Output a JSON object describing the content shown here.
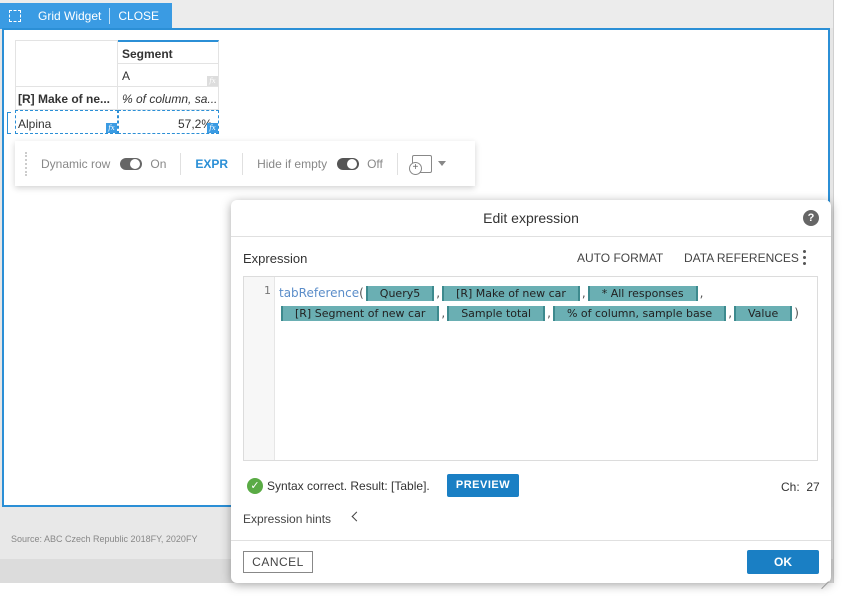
{
  "widget_tab": {
    "title": "Grid Widget",
    "close_label": "CLOSE"
  },
  "grid": {
    "column_header": "Segment",
    "column_sub": "A",
    "row_header": "[R] Make of ne...",
    "row_measure": "% of column, sa...",
    "row_label": "Alpina",
    "row_value": "57,2%",
    "fx_label": "fx"
  },
  "toolbar": {
    "dynamic_row_label": "Dynamic row",
    "dynamic_row_state": "On",
    "expr_label": "EXPR",
    "hide_if_empty_label": "Hide if empty",
    "hide_if_empty_state": "Off"
  },
  "footer": {
    "source": "Source: ABC Czech Republic 2018FY, 2020FY"
  },
  "dialog": {
    "title": "Edit expression",
    "help": "?",
    "expression_label": "Expression",
    "auto_format": "AUTO FORMAT",
    "data_references": "DATA REFERENCES",
    "line_number": "1",
    "function": "tabReference",
    "tokens_line1": [
      "Query5",
      "[R] Make of new car",
      "* All responses"
    ],
    "tokens_line2": [
      "[R] Segment of new car",
      "Sample total",
      "% of column, sample base",
      "Value"
    ],
    "status": "Syntax correct. Result: [Table].",
    "preview": "PREVIEW",
    "ch_label": "Ch:",
    "ch_value": "27",
    "hints": "Expression hints",
    "cancel": "CANCEL",
    "ok": "OK"
  }
}
